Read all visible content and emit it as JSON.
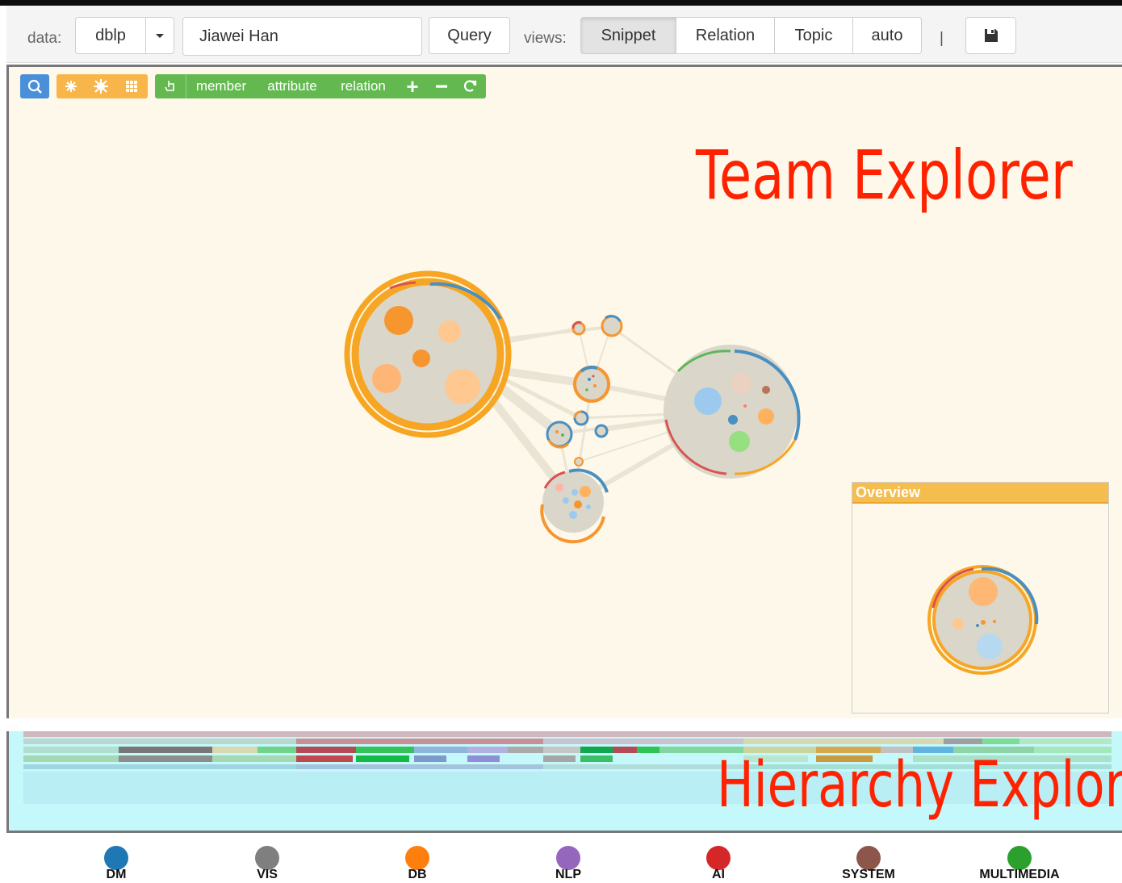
{
  "toolbar": {
    "data_label": "data:",
    "dataset": "dblp",
    "query_value": "Jiawei Han",
    "query_button": "Query",
    "views_label": "views:",
    "views": [
      "Snippet",
      "Relation",
      "Topic",
      "auto"
    ],
    "active_view": "Snippet",
    "separator": "|"
  },
  "graph_toolbar": {
    "member": "member",
    "attribute": "attribute",
    "relation": "relation"
  },
  "annotations": {
    "team_explorer": "Team Explorer",
    "hierarchy_explorer": "Hierarchy Explorer"
  },
  "overview": {
    "title": "Overview"
  },
  "legend": [
    {
      "label": "DM",
      "color": "#1f77b4"
    },
    {
      "label": "VIS",
      "color": "#7f7f7f"
    },
    {
      "label": "DB",
      "color": "#ff7f0e"
    },
    {
      "label": "NLP",
      "color": "#9467bd"
    },
    {
      "label": "AI",
      "color": "#d62728"
    },
    {
      "label": "SYSTEM",
      "color": "#8c564b"
    },
    {
      "label": "MULTIMEDIA",
      "color": "#2ca02c"
    }
  ]
}
